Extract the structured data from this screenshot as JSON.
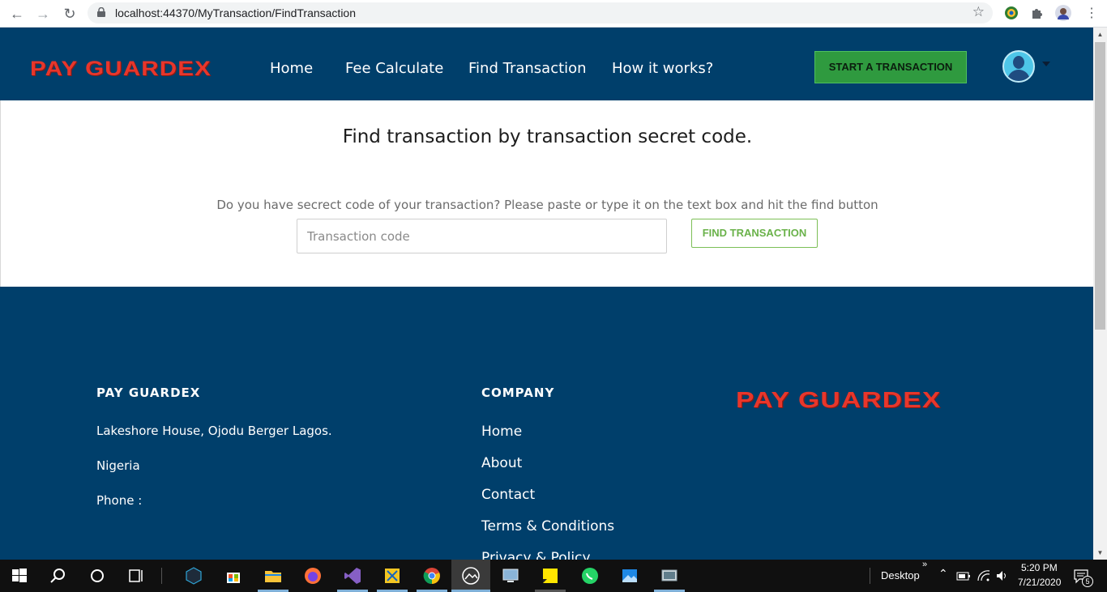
{
  "browser": {
    "url": "localhost:44370/MyTransaction/FindTransaction"
  },
  "header": {
    "logo": "PAY GUARDEX",
    "nav": [
      "Home",
      "Fee Calculate",
      "Find Transaction",
      "How it works?"
    ],
    "cta": "START A TRANSACTION"
  },
  "main": {
    "title": "Find transaction by transaction secret code.",
    "hint": "Do you have secrect code of your transaction? Please paste or type it on the text box and hit the find button",
    "input_placeholder": "Transaction code",
    "find_button": "FIND TRANSACTION"
  },
  "footer": {
    "brand_heading": "PAY GUARDEX",
    "address": "Lakeshore House, Ojodu Berger Lagos.",
    "country": "Nigeria",
    "phone": "Phone :",
    "company_heading": "COMPANY",
    "links": [
      "Home",
      "About",
      "Contact",
      "Terms & Conditions",
      "Privacy & Policy"
    ],
    "logo": "PAY GUARDEX"
  },
  "taskbar": {
    "desktop_label": "Desktop",
    "time": "5:20 PM",
    "date": "7/21/2020",
    "notification_count": "5"
  },
  "colors": {
    "header_bg": "#003f6b",
    "cta_green": "#2f9a3f",
    "logo_red": "#e8362b",
    "find_green": "#6ab24a"
  }
}
